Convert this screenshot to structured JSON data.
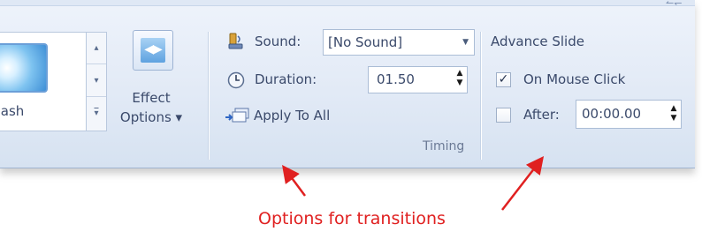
{
  "gallery": {
    "item_label": "Flash"
  },
  "effect_options": {
    "line1": "Effect",
    "line2": "Options ▾"
  },
  "timing": {
    "sound_label": "Sound:",
    "sound_value": "[No Sound]",
    "duration_label": "Duration:",
    "duration_value": "01.50",
    "apply_to_all_label": "Apply To All",
    "group_label": "Timing"
  },
  "advance_slide": {
    "heading": "Advance Slide",
    "on_mouse_click_label": "On Mouse Click",
    "on_mouse_click_checked": true,
    "after_label": "After:",
    "after_checked": false,
    "after_value": "00:00.00"
  },
  "annotation": {
    "caption": "Options for transitions",
    "color": "#e02020"
  }
}
